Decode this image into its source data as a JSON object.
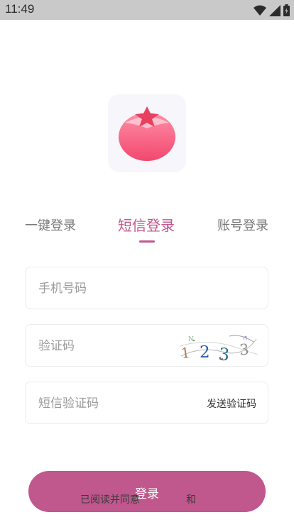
{
  "status_bar": {
    "time": "11:49"
  },
  "tabs": [
    {
      "label": "一键登录"
    },
    {
      "label": "短信登录"
    },
    {
      "label": "账号登录"
    }
  ],
  "form": {
    "phone_placeholder": "手机号码",
    "captcha_placeholder": "验证码",
    "captcha_text": "1 2 3 3",
    "sms_placeholder": "短信验证码",
    "send_code_label": "发送验证码"
  },
  "login_button": {
    "label": "登录"
  },
  "agreement": {
    "prefix": "已阅读并同意",
    "and": "和"
  },
  "colors": {
    "accent": "#c0578d",
    "status_bar": "#c9c9c9"
  }
}
